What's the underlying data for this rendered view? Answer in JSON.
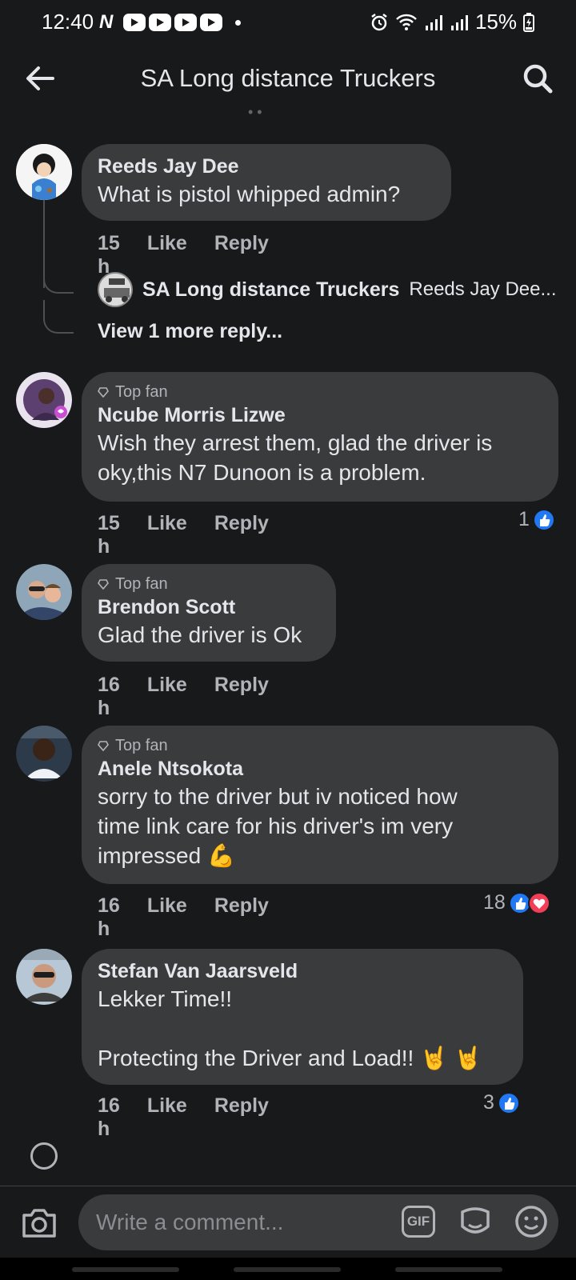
{
  "status_bar": {
    "time": "12:40",
    "battery": "15%"
  },
  "header": {
    "title": "SA Long distance Truckers"
  },
  "comments": [
    {
      "author": "Reeds Jay Dee",
      "text": "What is pistol whipped admin?",
      "top_fan": "",
      "time": "15 h",
      "like": "Like",
      "reply": "Reply",
      "reactions": ""
    },
    {
      "author": "Ncube Morris Lizwe",
      "text": "Wish they arrest them, glad the driver is\noky,this N7 Dunoon is a problem.",
      "top_fan": "Top fan",
      "time": "15 h",
      "like": "Like",
      "reply": "Reply",
      "reactions": "1"
    },
    {
      "author": "Brendon Scott",
      "text": "Glad the driver is Ok",
      "top_fan": "Top fan",
      "time": "16 h",
      "like": "Like",
      "reply": "Reply",
      "reactions": ""
    },
    {
      "author": "Anele Ntsokota",
      "text": "sorry to the driver but iv noticed how\ntime link care for his driver's im very\nimpressed 💪",
      "top_fan": "Top fan",
      "time": "16 h",
      "like": "Like",
      "reply": "Reply",
      "reactions": "18"
    },
    {
      "author": "Stefan Van Jaarsveld",
      "text": "Lekker Time!!\n\nProtecting the Driver and Load!! 🤘 🤘",
      "top_fan": "",
      "time": "16 h",
      "like": "Like",
      "reply": "Reply",
      "reactions": "3"
    }
  ],
  "reply_preview": {
    "author": "SA Long distance Truckers",
    "snippet": "Reeds Jay Dee...",
    "view_more": "View 1 more reply..."
  },
  "composer": {
    "placeholder": "Write a comment...",
    "gif_label": "GIF"
  },
  "icons": {
    "back": "back-arrow-icon",
    "search": "search-icon",
    "camera": "camera-icon",
    "gif": "gif-icon",
    "sticker": "sticker-icon",
    "emoji": "emoji-icon",
    "like_reaction": "like-reaction-icon",
    "love_reaction": "love-reaction-icon",
    "top_fan": "top-fan-badge-icon"
  },
  "colors": {
    "background": "#18191a",
    "bubble": "#3a3b3c",
    "like_blue": "#2078f4",
    "love_red": "#f33e58",
    "meta_text": "#b0b3b8"
  }
}
